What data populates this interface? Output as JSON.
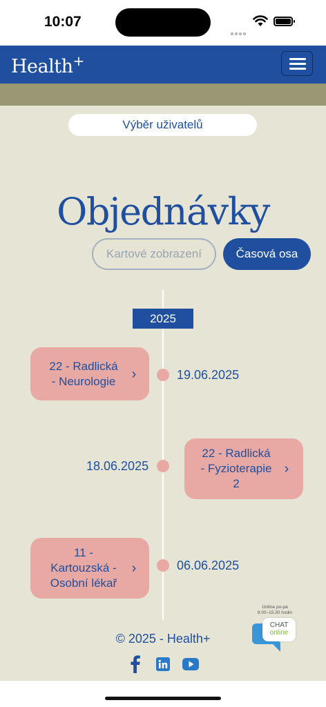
{
  "status_bar": {
    "time": "10:07"
  },
  "header": {
    "logo": "Health",
    "logo_plus": "+"
  },
  "user_select": {
    "label": "Výběr uživatelů"
  },
  "page": {
    "title": "Objednávky"
  },
  "view_toggle": {
    "card_view": "Kartové zobrazení",
    "timeline": "Časová osa"
  },
  "timeline": {
    "year": "2025",
    "items": [
      {
        "line1": "22 - Radlická",
        "line2": "- Neurologie",
        "line3": "",
        "date": "19.06.2025",
        "side": "left"
      },
      {
        "line1": "22 - Radlická",
        "line2": "- Fyzioterapie",
        "line3": "2",
        "date": "18.06.2025",
        "side": "right"
      },
      {
        "line1": "11 -",
        "line2": "Kartouzská -",
        "line3": "Osobní lékař",
        "date": "06.06.2025",
        "side": "left"
      }
    ]
  },
  "footer": {
    "copyright": "© 2025 - Health+"
  },
  "chat": {
    "hours_line1": "Online po-pá",
    "hours_line2": "8.00–15.30 hodin",
    "label": "CHAT",
    "status": "online"
  },
  "colors": {
    "brand_blue": "#1f4f9e",
    "card_pink": "#e8a9a4",
    "background": "#e6e4d5",
    "olive": "#9a9874"
  },
  "icons": [
    "menu-icon",
    "chevron-right-icon",
    "facebook-icon",
    "linkedin-icon",
    "youtube-icon",
    "chat-icon"
  ]
}
